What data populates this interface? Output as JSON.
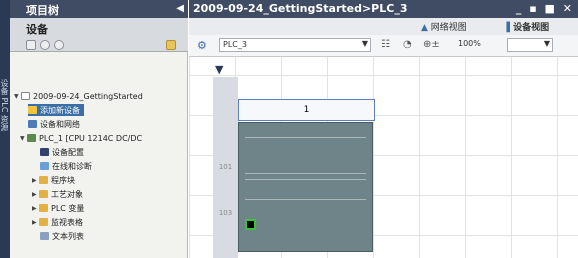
{
  "side_tab": {
    "label": "设备 PLC 资源"
  },
  "project_tree": {
    "title": "项目树",
    "collapse_icon": "triangle-left-icon",
    "devices_heading": "设备",
    "items": [
      {
        "label": "2009-09-24_GettingStarted",
        "level": 0,
        "icon": "project-icon"
      },
      {
        "label": "添加新设备",
        "level": 1,
        "icon": "add-device-icon",
        "selected": true
      },
      {
        "label": "设备和网络",
        "level": 1,
        "icon": "network-icon"
      },
      {
        "label": "PLC_1 [CPU 1214C DC/DC",
        "level": 1,
        "icon": "plc-icon"
      },
      {
        "label": "设备配置",
        "level": 2,
        "icon": "config-icon"
      },
      {
        "label": "在线和诊断",
        "level": 2,
        "icon": "diagnostics-icon"
      },
      {
        "label": "程序块",
        "level": 2,
        "icon": "folder-icon"
      },
      {
        "label": "工艺对象",
        "level": 2,
        "icon": "folder-icon"
      },
      {
        "label": "PLC 变量",
        "level": 2,
        "icon": "folder-icon"
      },
      {
        "label": "监视表格",
        "level": 2,
        "icon": "folder-icon"
      },
      {
        "label": "文本列表",
        "level": 2,
        "icon": "list-icon"
      }
    ]
  },
  "editor": {
    "title": "2009-09-24_GettingStarted>PLC_3",
    "network_view": "网络视图",
    "device_view": "设备视图",
    "device_select": "PLC_3",
    "zoom": "100%",
    "slot_header": "1",
    "row_labels": [
      "101",
      "103"
    ]
  },
  "colors": {
    "title_bar": "#3f4c63",
    "selection": "#3a6ea5",
    "cpu_body": "#6f8488",
    "led": "#3cc13c"
  }
}
